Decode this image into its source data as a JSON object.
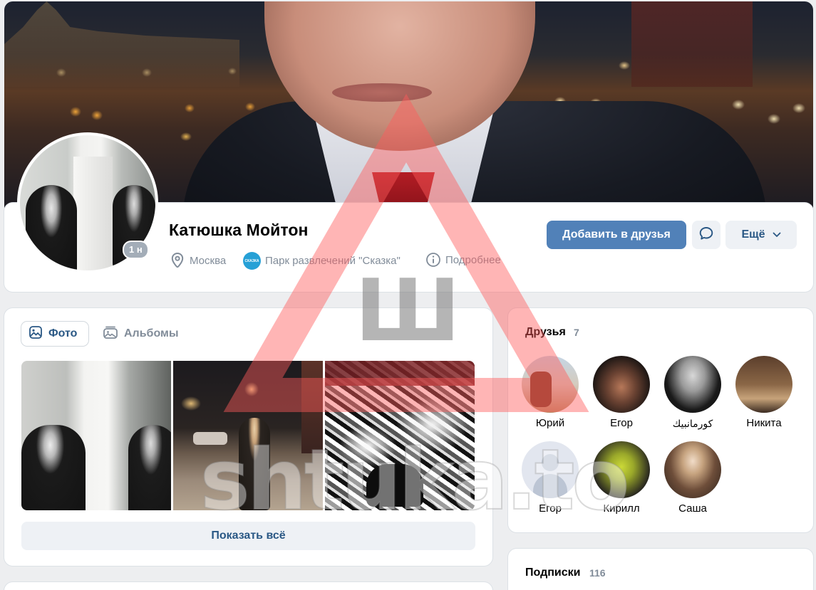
{
  "profile": {
    "name": "Катюшка Мойтон",
    "online_badge": "1 н",
    "city": "Москва",
    "work": "Парк развлечений \"Сказка\"",
    "details_label": "Подробнее"
  },
  "actions": {
    "add_friend_label": "Добавить в друзья",
    "more_label": "Ещё"
  },
  "photos": {
    "tabs": [
      {
        "label": "Фото",
        "active": true
      },
      {
        "label": "Альбомы",
        "active": false
      }
    ],
    "show_all_label": "Показать всё"
  },
  "friends": {
    "title": "Друзья",
    "count": "7",
    "items": [
      {
        "name": "Юрий"
      },
      {
        "name": "Егор"
      },
      {
        "name": "کورمانبیك"
      },
      {
        "name": "Никита"
      },
      {
        "name": "Егор"
      },
      {
        "name": "Кирилл"
      },
      {
        "name": "Саша"
      }
    ]
  },
  "subscriptions": {
    "title": "Подписки",
    "count": "116"
  },
  "watermark": {
    "letter": "Ш",
    "text": "shtuka.to"
  },
  "colors": {
    "accent": "#5181b8",
    "link": "#2a5885",
    "muted": "#818c99",
    "background": "#edeef0",
    "watermark_red": "#ff5a5a"
  },
  "icons": {
    "city": "location-pin-icon",
    "work": "work-logo-icon",
    "details": "info-icon",
    "message": "message-bubble-icon",
    "more": "chevron-down-icon",
    "photo_tab": "photo-icon",
    "albums_tab": "albums-icon"
  }
}
